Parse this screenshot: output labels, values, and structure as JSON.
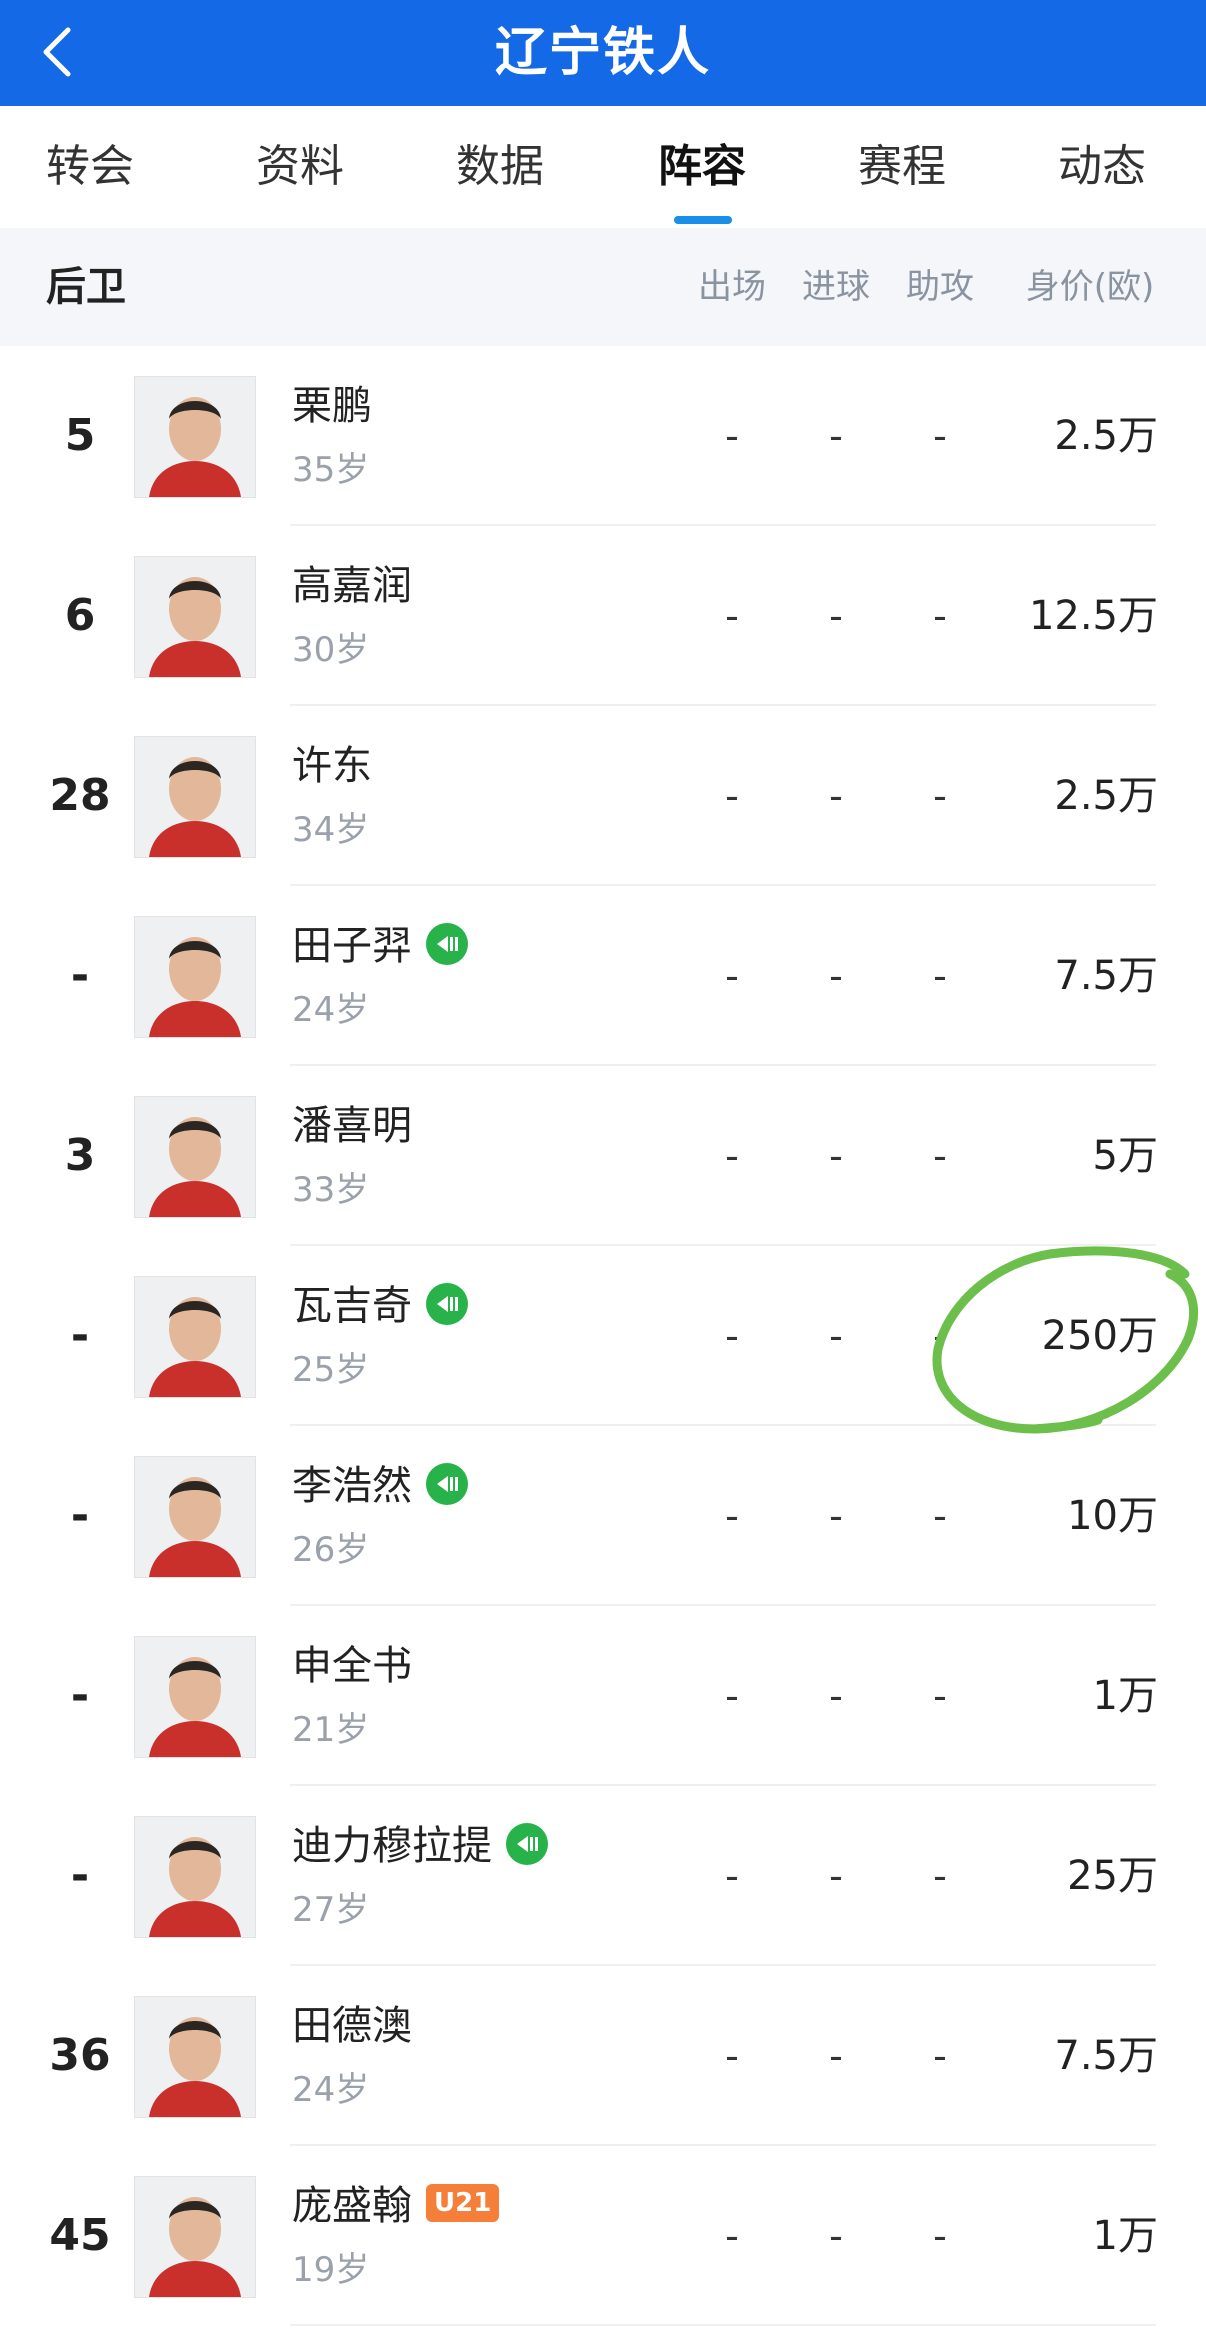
{
  "header": {
    "title": "辽宁铁人"
  },
  "tabs": [
    {
      "label": "转会",
      "active": false
    },
    {
      "label": "资料",
      "active": false
    },
    {
      "label": "数据",
      "active": false
    },
    {
      "label": "阵容",
      "active": true
    },
    {
      "label": "赛程",
      "active": false
    },
    {
      "label": "动态",
      "active": false
    }
  ],
  "section": {
    "title": "后卫",
    "columns": [
      "出场",
      "进球",
      "助攻",
      "身价(欧)"
    ]
  },
  "players": [
    {
      "number": "5",
      "name": "栗鹏",
      "age": "35岁",
      "apps": "-",
      "goals": "-",
      "assists": "-",
      "value": "2.5万",
      "badge": ""
    },
    {
      "number": "6",
      "name": "高嘉润",
      "age": "30岁",
      "apps": "-",
      "goals": "-",
      "assists": "-",
      "value": "12.5万",
      "badge": ""
    },
    {
      "number": "28",
      "name": "许东",
      "age": "34岁",
      "apps": "-",
      "goals": "-",
      "assists": "-",
      "value": "2.5万",
      "badge": ""
    },
    {
      "number": "-",
      "name": "田子羿",
      "age": "24岁",
      "apps": "-",
      "goals": "-",
      "assists": "-",
      "value": "7.5万",
      "badge": "transfer-in"
    },
    {
      "number": "3",
      "name": "潘喜明",
      "age": "33岁",
      "apps": "-",
      "goals": "-",
      "assists": "-",
      "value": "5万",
      "badge": ""
    },
    {
      "number": "-",
      "name": "瓦吉奇",
      "age": "25岁",
      "apps": "-",
      "goals": "-",
      "assists": "-",
      "value": "250万",
      "badge": "transfer-in"
    },
    {
      "number": "-",
      "name": "李浩然",
      "age": "26岁",
      "apps": "-",
      "goals": "-",
      "assists": "-",
      "value": "10万",
      "badge": "transfer-in"
    },
    {
      "number": "-",
      "name": "申全书",
      "age": "21岁",
      "apps": "-",
      "goals": "-",
      "assists": "-",
      "value": "1万",
      "badge": ""
    },
    {
      "number": "-",
      "name": "迪力穆拉提",
      "age": "27岁",
      "apps": "-",
      "goals": "-",
      "assists": "-",
      "value": "25万",
      "badge": "transfer-in"
    },
    {
      "number": "36",
      "name": "田德澳",
      "age": "24岁",
      "apps": "-",
      "goals": "-",
      "assists": "-",
      "value": "7.5万",
      "badge": ""
    },
    {
      "number": "45",
      "name": "庞盛翰",
      "age": "19岁",
      "apps": "-",
      "goals": "-",
      "assists": "-",
      "value": "1万",
      "badge": "U21"
    }
  ],
  "colors": {
    "header_bg": "#1469e6",
    "active_tab_indicator": "#1a8fe8",
    "badge_green": "#27b34a",
    "badge_u21": "#f57f39",
    "annotation": "#6cbf4a"
  },
  "icons": {
    "back": "chevron-left-icon",
    "transfer_badge": "arrow-in-icon"
  }
}
